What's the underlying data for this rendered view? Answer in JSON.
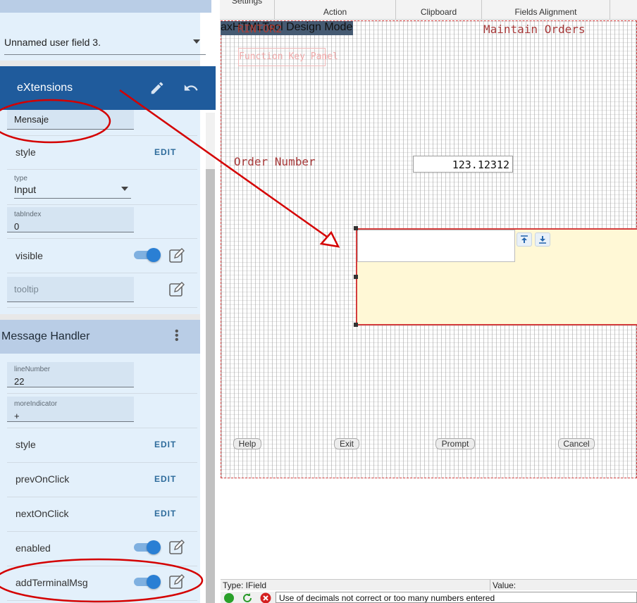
{
  "left_panel": {
    "top_select_value": "Unnamed user field 3.",
    "extensions": {
      "title": "eXtensions",
      "name_value": "Mensaje",
      "style_label": "style",
      "edit_label": "EDIT",
      "type_label": "type",
      "type_value": "Input",
      "tabindex_label": "tabIndex",
      "tabindex_value": "0",
      "visible_label": "visible",
      "tooltip_label": "tooltip"
    },
    "message_handler": {
      "title": "Message Handler",
      "linenumber_label": "lineNumber",
      "linenumber_value": "22",
      "moreindicator_label": "moreIndicator",
      "moreindicator_value": "+",
      "style_label": "style",
      "prevonclick_label": "prevOnClick",
      "nextonclick_label": "nextOnClick",
      "enabled_label": "enabled",
      "addterminalmsg_label": "addTerminalMsg",
      "edit_label": "EDIT"
    }
  },
  "toolbar": {
    "settings": "Settings",
    "action": "Action",
    "clipboard": "Clipboard",
    "fields_alignment": "Fields Alignment"
  },
  "canvas": {
    "title_overlay": "axHTMLTool Design Mode",
    "program_name": "RINTOR2",
    "screen_title": "Maintain Orders",
    "function_key_panel": "Function Key Panel",
    "order_number_label": "Order Number",
    "order_number_value": "123.12312",
    "buttons": {
      "help": "Help",
      "exit": "Exit",
      "prompt": "Prompt",
      "cancel": "Cancel"
    }
  },
  "status": {
    "type_text": "Type: IField",
    "value_label": "Value:",
    "message": "Use of decimals not correct or too many numbers entered"
  },
  "colors": {
    "accent_dark": "#1f5b9c",
    "header_light": "#b9cde6",
    "annotation_red": "#d40000",
    "screen_text": "#a83a3a"
  }
}
